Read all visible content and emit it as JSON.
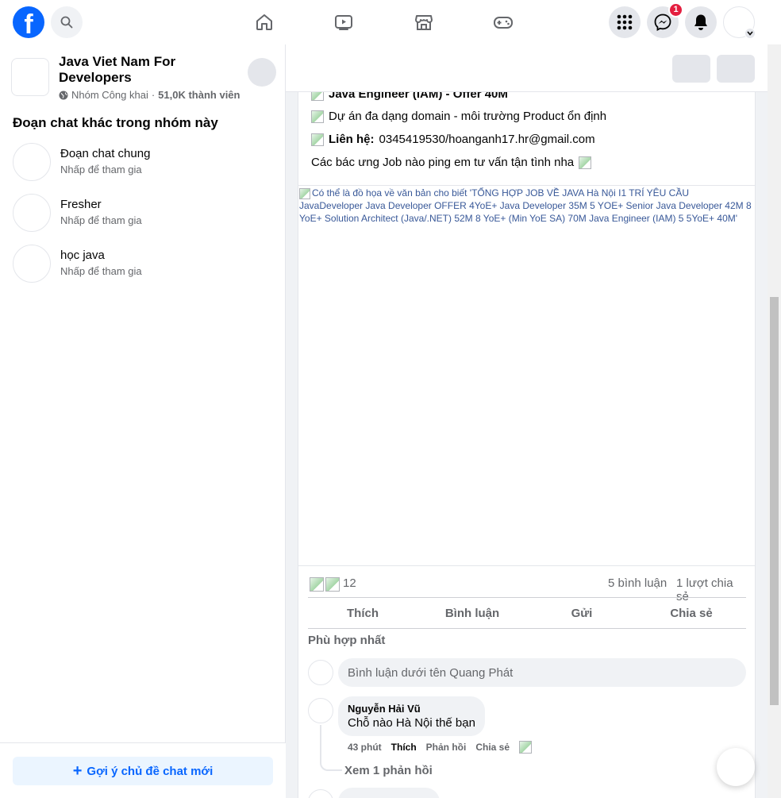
{
  "colors": {
    "brand": "#0866ff",
    "badge": "#e41e3f",
    "muted": "#65676b"
  },
  "topbar": {
    "logo_icon": "facebook-logo",
    "search_icon": "search-icon",
    "nav": [
      "home-icon",
      "watch-icon",
      "marketplace-icon",
      "gaming-icon"
    ],
    "menu_icon": "grid-menu-icon",
    "messenger_icon": "messenger-icon",
    "messenger_badge": "1",
    "notifications_icon": "bell-icon"
  },
  "sidebar": {
    "group_name": "Java Viet Nam For Developers",
    "group_privacy": "Nhóm Công khai",
    "group_separator": "·",
    "group_members": "51,0K thành viên",
    "section_title": "Đoạn chat khác trong nhóm này",
    "chats": [
      {
        "name": "Đoạn chat chung",
        "subtitle": "Nhấp để tham gia"
      },
      {
        "name": "Fresher",
        "subtitle": "Nhấp để tham gia"
      },
      {
        "name": "học java",
        "subtitle": "Nhấp để tham gia"
      }
    ],
    "suggest_button": "Gợi ý chủ đề chat mới"
  },
  "post": {
    "line1": "Java Engineer (IAM) - Offer 40M",
    "line2": "Dự án đa dạng domain - môi trường Product ổn định",
    "line3_label": "Liên hệ:",
    "line3_value": "0345419530/hoanganh17.hr@gmail.com",
    "line4": "Các bác ưng Job nào ping em tư vấn tận tình nha",
    "image_alt": "Có thể là đồ họa về văn bản cho biết 'TỔNG HỢP JOB VỀ JAVA Hà Nội I1 TRÍ YÊU CẦU JavaDeveloper Java Developer OFFER 4YoE+ Java Developer 35M 5 YOE+ Senior Java Developer 42M 8 YoE+ Solution Architect (Java/.NET) 52M 8 YoE+ (Min YoE SA) 70M Java Engineer (IAM) 5 5YoE+ 40M'",
    "reaction_count": "12",
    "comments_count": "5 bình luận",
    "shares_count": "1 lượt chia sẻ",
    "actions": {
      "like": "Thích",
      "comment": "Bình luận",
      "send": "Gửi",
      "share": "Chia sẻ"
    },
    "sort_label": "Phù hợp nhất",
    "comment_placeholder": "Bình luận dưới tên Quang Phát"
  },
  "comments": [
    {
      "author": "Nguyễn Hải Vũ",
      "text": "Chỗ nào Hà Nội thế bạn",
      "time": "43 phút",
      "like": "Thích",
      "reply": "Phản hồi",
      "share": "Chia sẻ",
      "view_replies": "Xem 1 phản hồi"
    }
  ]
}
